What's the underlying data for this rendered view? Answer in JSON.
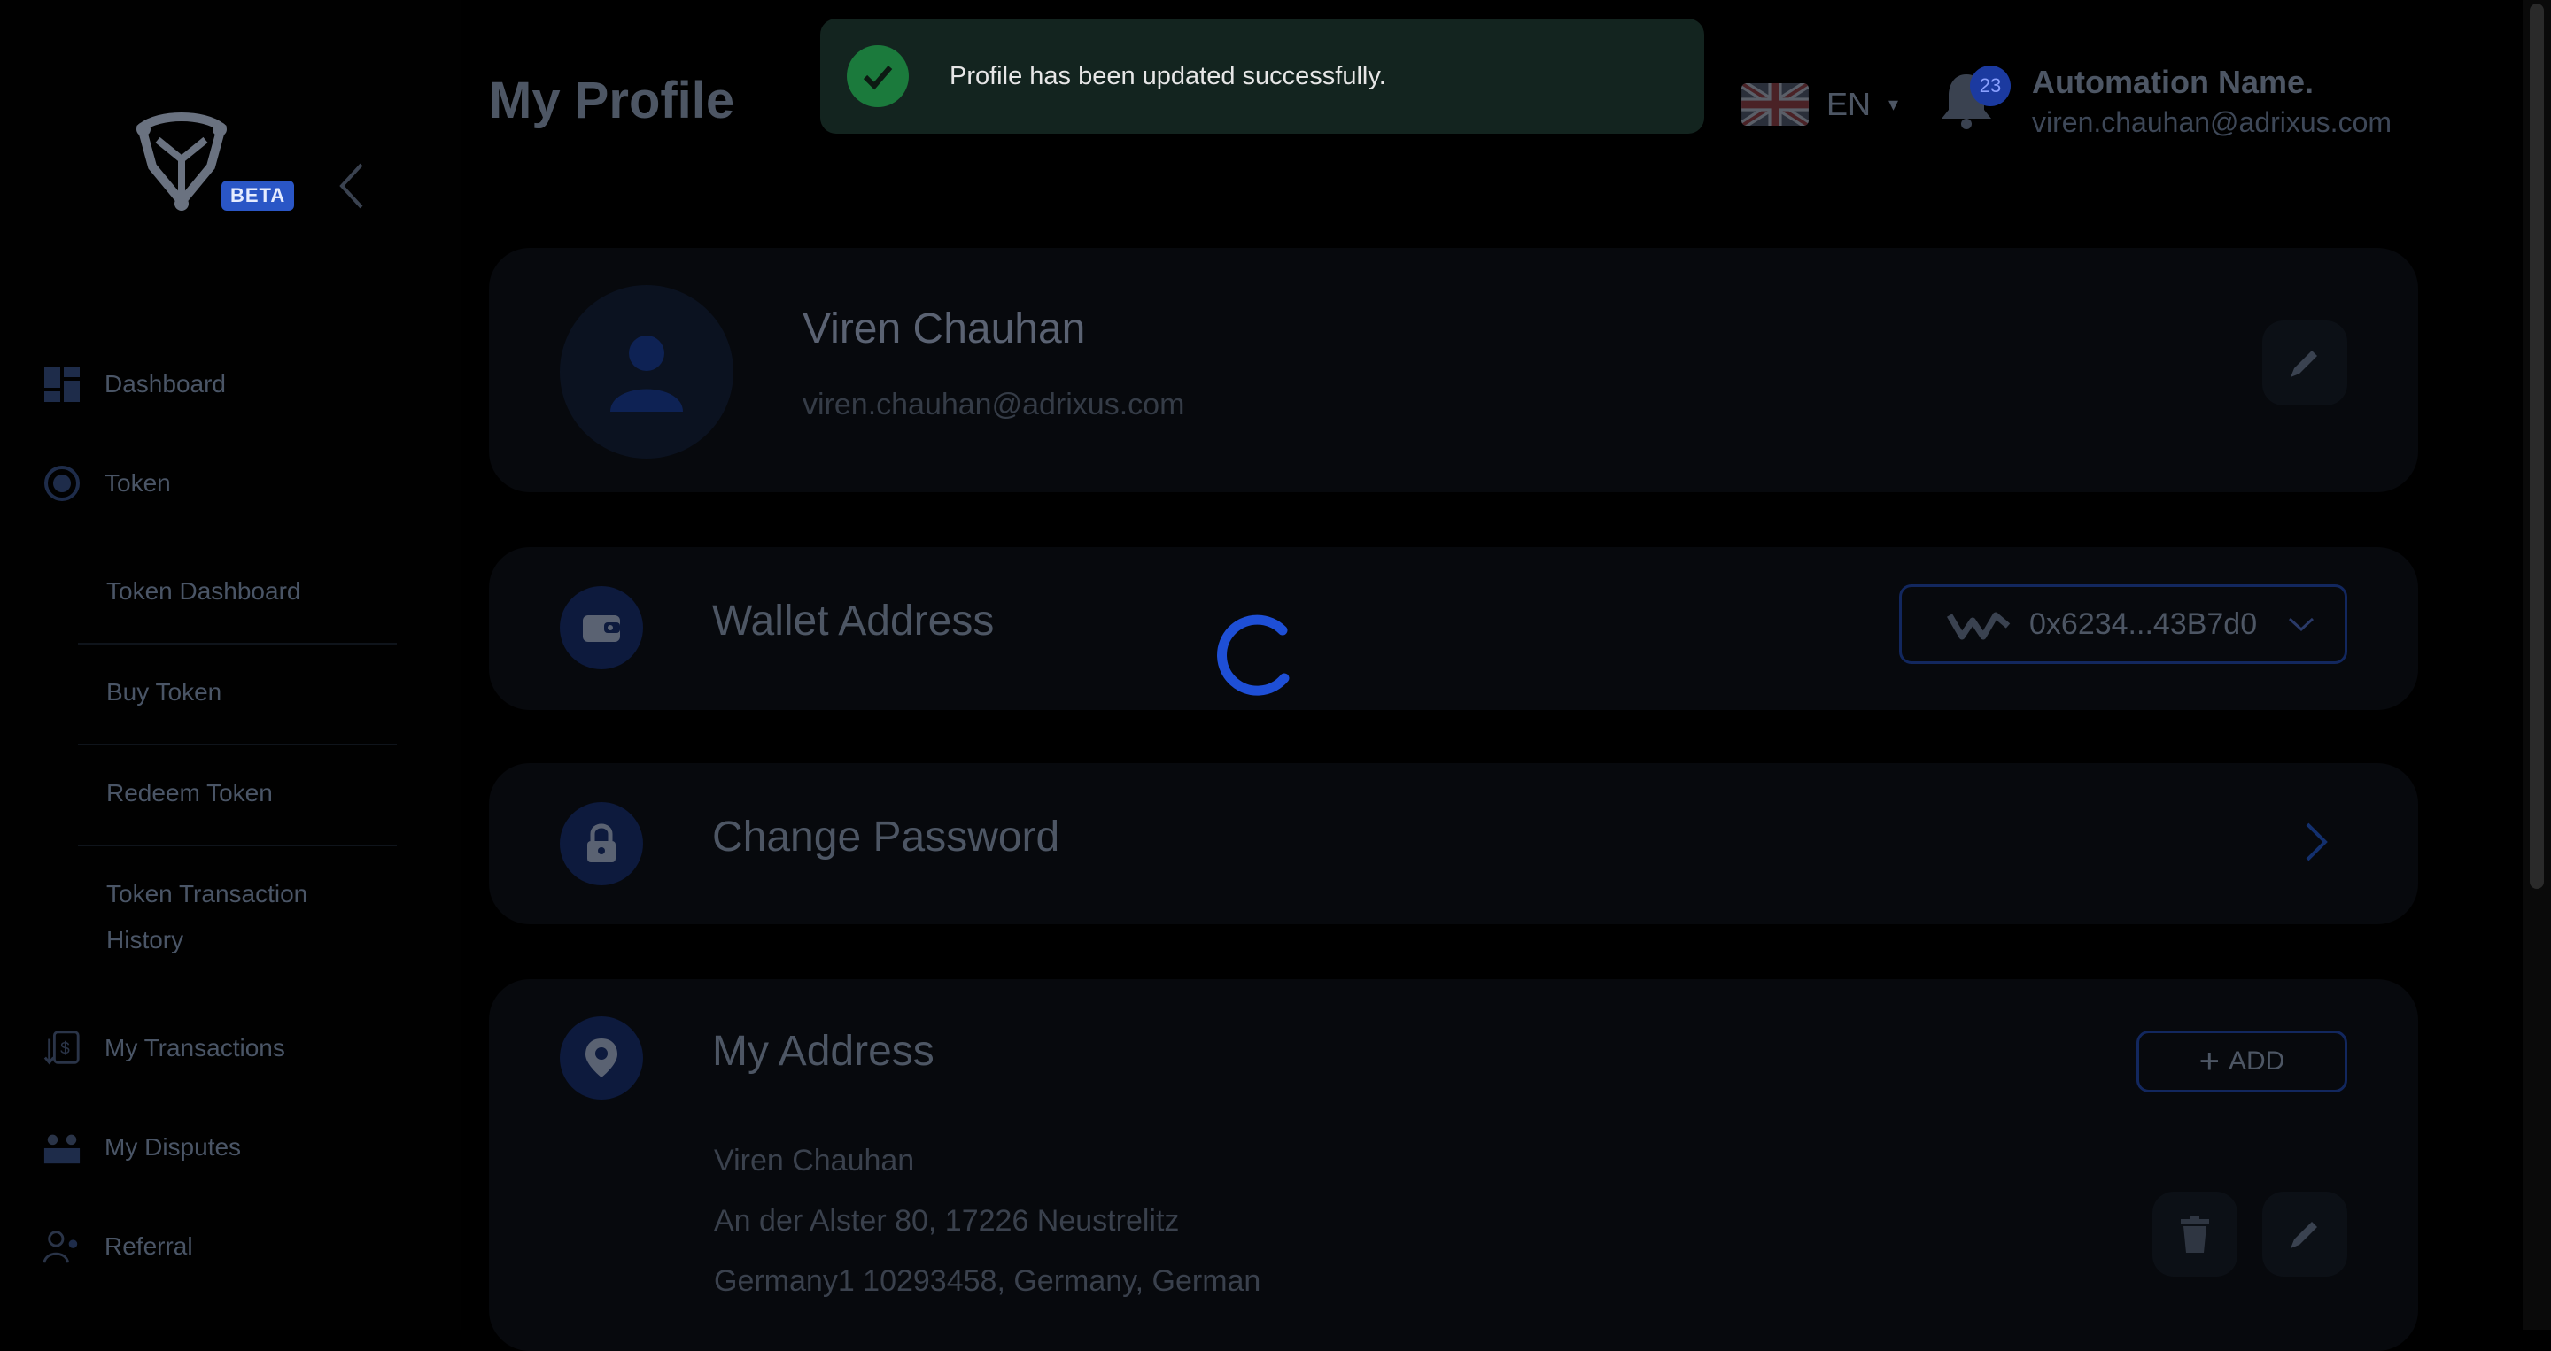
{
  "sidebar": {
    "beta_label": "BETA",
    "nav": {
      "dashboard": "Dashboard",
      "token": "Token",
      "token_dashboard": "Token Dashboard",
      "buy_token": "Buy Token",
      "redeem_token": "Redeem Token",
      "token_tx_history_line1": "Token Transaction",
      "token_tx_history_line2": "History",
      "my_transactions": "My Transactions",
      "my_disputes": "My Disputes",
      "referral": "Referral"
    }
  },
  "header": {
    "title": "My Profile",
    "toast_message": "Profile has been updated successfully.",
    "language": "EN",
    "notification_count": "23",
    "user_name": "Automation Name.",
    "user_email": "viren.chauhan@adrixus.com"
  },
  "profile": {
    "name": "Viren Chauhan",
    "email": "viren.chauhan@adrixus.com"
  },
  "wallet": {
    "title": "Wallet Address",
    "address": "0x6234...43B7d0"
  },
  "password": {
    "title": "Change Password"
  },
  "address": {
    "title": "My Address",
    "add_label": "ADD",
    "name": "Viren Chauhan",
    "line1": "An der Alster 80, 17226 Neustrelitz",
    "line2": "Germany1 10293458, Germany, German"
  },
  "colors": {
    "accent": "#1e4fd6",
    "success": "#1b7a3c",
    "toast_bg": "#13241f"
  }
}
